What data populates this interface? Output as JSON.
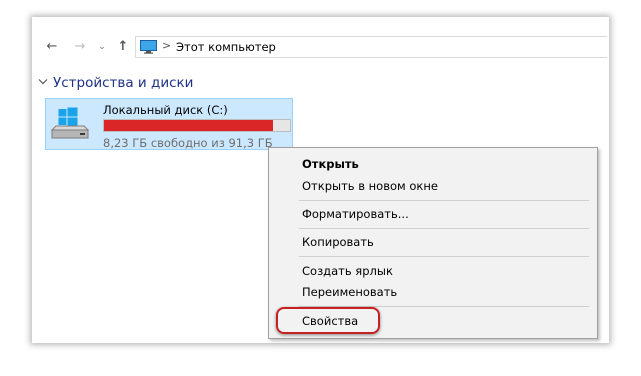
{
  "navigation": {
    "back_icon": "arrow-left-icon",
    "forward_icon": "arrow-right-icon",
    "recent_icon": "chevron-down-icon",
    "up_icon": "arrow-up-icon",
    "address": {
      "icon": "computer-icon",
      "separator": ">",
      "location": "Этот компьютер"
    }
  },
  "section": {
    "title": "Устройства и диски",
    "color": "#1e3287"
  },
  "drive": {
    "name": "Локальный диск (C:)",
    "space_text": "8,23 ГБ свободно из 91,3 ГБ",
    "used_fraction": 0.91,
    "bar_color": "#da2626",
    "tile_color": "#cce8ff",
    "icon": "windows-drive-icon"
  },
  "context_menu": {
    "items": [
      {
        "label": "Открыть",
        "bold": true
      },
      {
        "label": "Открыть в новом окне"
      },
      {
        "label": "Форматировать..."
      },
      {
        "label": "Копировать"
      },
      {
        "label": "Создать ярлык"
      },
      {
        "label": "Переименовать"
      },
      {
        "label": "Свойства",
        "highlighted": true
      }
    ],
    "highlight_color": "#c62121"
  }
}
